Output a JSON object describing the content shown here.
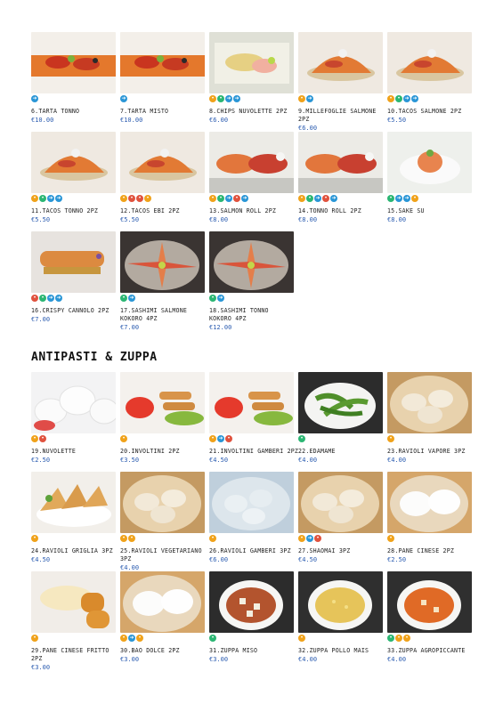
{
  "section_title": "ANTIPASTI & ZUPPA",
  "top_items": [
    {
      "name": "6.TARTA TONNO",
      "price": "€10.00",
      "icons": [
        "b"
      ],
      "theme": "tartare"
    },
    {
      "name": "7.TARTA MISTO",
      "price": "€10.00",
      "icons": [
        "b"
      ],
      "theme": "tartare"
    },
    {
      "name": "8.CHIPS NUVOLETTE 2PZ",
      "price": "€6.00",
      "icons": [
        "o",
        "g",
        "b",
        "b"
      ],
      "theme": "chips"
    },
    {
      "name": "9.MILLEFOGLIE SALMONE 2PZ",
      "price": "€6.00",
      "icons": [
        "o",
        "b"
      ],
      "theme": "taco"
    },
    {
      "name": "10.TACOS SALMONE 2PZ",
      "price": "€5.50",
      "icons": [
        "o",
        "g",
        "b",
        "b"
      ],
      "theme": "taco"
    },
    {
      "name": "11.TACOS TONNO 2PZ",
      "price": "€5.50",
      "icons": [
        "o",
        "g",
        "b",
        "b"
      ],
      "theme": "taco"
    },
    {
      "name": "12.TACOS EBI 2PZ",
      "price": "€5.50",
      "icons": [
        "o",
        "r",
        "r",
        "o"
      ],
      "theme": "taco"
    },
    {
      "name": "13.SALMON ROLL 2PZ",
      "price": "€8.00",
      "icons": [
        "o",
        "g",
        "b",
        "r",
        "b"
      ],
      "theme": "roll"
    },
    {
      "name": "14.TONNO ROLL 2PZ",
      "price": "€8.00",
      "icons": [
        "o",
        "g",
        "b",
        "r",
        "b"
      ],
      "theme": "roll"
    },
    {
      "name": "15.SAKE SU",
      "price": "€8.00",
      "icons": [
        "g",
        "b",
        "b",
        "o"
      ],
      "theme": "sakesu"
    },
    {
      "name": "16.CRISPY CANNOLO 2PZ",
      "price": "€7.00",
      "icons": [
        "r",
        "g",
        "b",
        "b"
      ],
      "theme": "cannolo"
    },
    {
      "name": "17.SASHIMI SALMONE KOKORO 4PZ",
      "price": "€7.00",
      "icons": [
        "g",
        "b"
      ],
      "theme": "sashimi"
    },
    {
      "name": "18.SASHIMI TONNO KOKORO 4PZ",
      "price": "€12.00",
      "icons": [
        "g",
        "b"
      ],
      "theme": "sashimi"
    }
  ],
  "bottom_items": [
    {
      "name": "19.NUVOLETTE",
      "price": "€2.50",
      "icons": [
        "o",
        "r"
      ],
      "theme": "nuvolette"
    },
    {
      "name": "20.INVOLTINI 2PZ",
      "price": "€3.50",
      "icons": [
        "o"
      ],
      "theme": "involtini"
    },
    {
      "name": "21.INVOLTINI GAMBERI 2PZ",
      "price": "€4.50",
      "icons": [
        "o",
        "b",
        "r"
      ],
      "theme": "involtini"
    },
    {
      "name": "22.EDAMAME",
      "price": "€4.00",
      "icons": [
        "g"
      ],
      "theme": "edamame"
    },
    {
      "name": "23.RAVIOLI VAPORE 3PZ",
      "price": "€4.00",
      "icons": [
        "o"
      ],
      "theme": "steamer"
    },
    {
      "name": "24.RAVIOLI GRIGLIA 3PZ",
      "price": "€4.50",
      "icons": [
        "o"
      ],
      "theme": "griglia"
    },
    {
      "name": "25.RAVIOLI VEGETARIANO 3PZ",
      "price": "€4.00",
      "icons": [
        "o",
        "o"
      ],
      "theme": "steamer"
    },
    {
      "name": "26.RAVIOLI GAMBERI 3PZ",
      "price": "€6.00",
      "icons": [
        "o"
      ],
      "theme": "gamberi"
    },
    {
      "name": "27.SHAOMAI 3PZ",
      "price": "€4.50",
      "icons": [
        "o",
        "b",
        "r"
      ],
      "theme": "steamer"
    },
    {
      "name": "28.PANE CINESE 2PZ",
      "price": "€2.50",
      "icons": [
        "o"
      ],
      "theme": "pane"
    },
    {
      "name": "29.PANE CINESE FRITTO 2PZ",
      "price": "€3.00",
      "icons": [
        "o"
      ],
      "theme": "fritto"
    },
    {
      "name": "30.BAO DOLCE 2PZ",
      "price": "€3.00",
      "icons": [
        "o",
        "b",
        "o"
      ],
      "theme": "pane"
    },
    {
      "name": "31.ZUPPA MISO",
      "price": "€3.00",
      "icons": [
        "g"
      ],
      "theme": "miso"
    },
    {
      "name": "32.ZUPPA POLLO MAIS",
      "price": "€4.00",
      "icons": [
        "o"
      ],
      "theme": "mais"
    },
    {
      "name": "33.ZUPPA AGROPICCANTE",
      "price": "€4.00",
      "icons": [
        "g",
        "o",
        "o"
      ],
      "theme": "agro"
    }
  ]
}
